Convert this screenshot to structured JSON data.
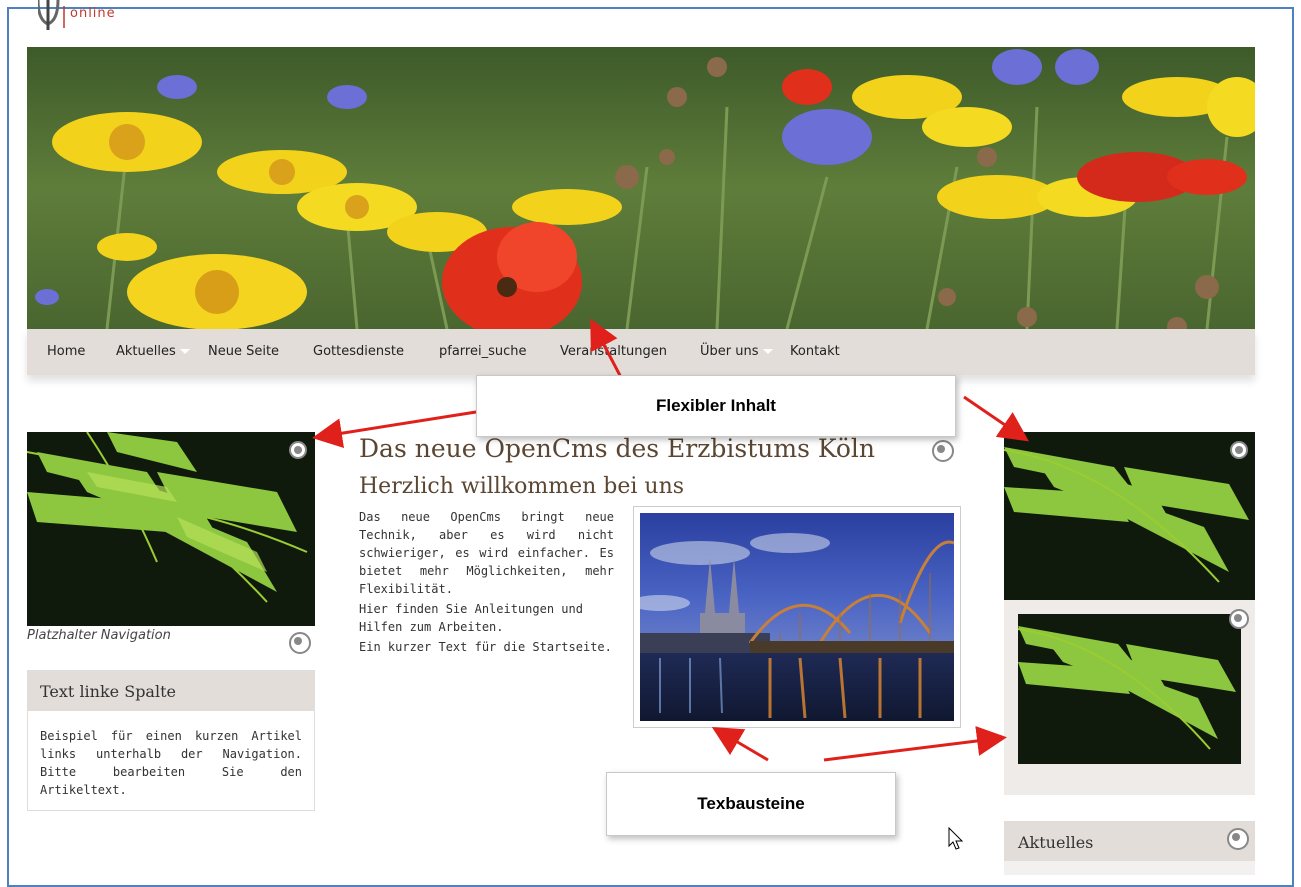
{
  "brand": {
    "logo_text": "online"
  },
  "nav": {
    "items": [
      {
        "label": "Home",
        "has_dropdown": false
      },
      {
        "label": "Aktuelles",
        "has_dropdown": true
      },
      {
        "label": "Neue Seite",
        "has_dropdown": false
      },
      {
        "label": "Gottesdienste",
        "has_dropdown": false
      },
      {
        "label": "pfarrei_suche",
        "has_dropdown": false
      },
      {
        "label": "Veranstaltungen",
        "has_dropdown": false
      },
      {
        "label": "Über uns",
        "has_dropdown": true
      },
      {
        "label": "Kontakt",
        "has_dropdown": false
      }
    ]
  },
  "callouts": {
    "flexibler_inhalt": "Flexibler Inhalt",
    "texbausteine": "Texbausteine"
  },
  "left_column": {
    "caption": "Platzhalter Navigation",
    "box_title": "Text linke Spalte",
    "box_text": "Beispiel für einen kurzen Artikel links unterhalb der Navigation. Bitte bearbeiten Sie den Artikeltext."
  },
  "main": {
    "title": "Das neue OpenCms des Erzbistums Köln",
    "subtitle": "Herzlich willkommen bei uns",
    "paragraphs": [
      "Das neue OpenCms bringt neue Technik, aber es wird nicht schwieriger, es wird einfacher. Es bietet mehr Möglichkeiten, mehr Flexibilität.",
      "Hier finden Sie Anleitungen und Hilfen zum Arbeiten.",
      "Ein kurzer Text für die Startseite."
    ]
  },
  "right_column": {
    "aktuelles_label": "Aktuelles"
  },
  "colors": {
    "nav_bg": "#e2ddd8",
    "heading_brown": "#5a4632",
    "arrow_red": "#e0201b",
    "frame_blue": "#4f81bd"
  }
}
